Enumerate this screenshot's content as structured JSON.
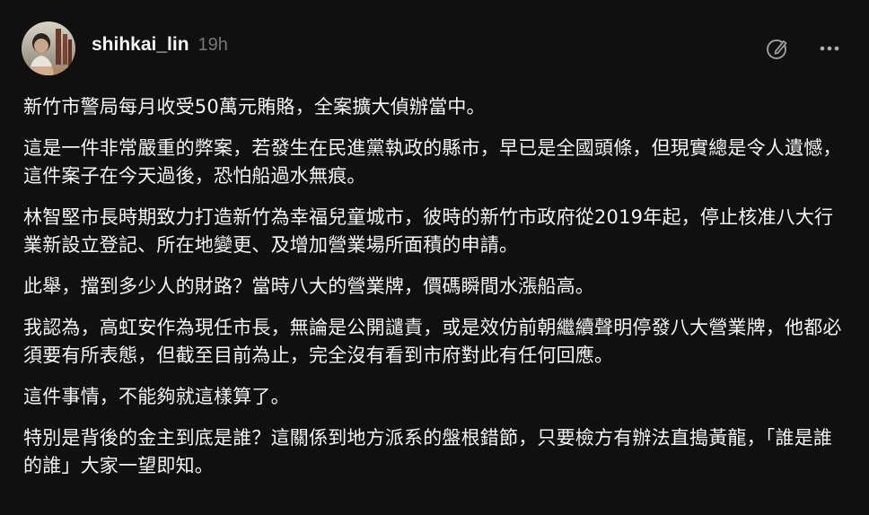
{
  "post": {
    "author": "shihkai_lin",
    "timestamp": "19h",
    "avatar_icon": "user-avatar-photo",
    "actions": {
      "edit_icon": "edit-pencil-circle-icon",
      "more_icon": "more-horizontal-icon"
    },
    "paragraphs": [
      "新竹市警局每月收受50萬元賄賂，全案擴大偵辦當中。",
      "這是一件非常嚴重的弊案，若發生在民進黨執政的縣市，早已是全國頭條，但現實總是令人遺憾，這件案子在今天過後，恐怕船過水無痕。",
      "林智堅市長時期致力打造新竹為幸福兒童城市，彼時的新竹市政府從2019年起，停止核准八大行業新設立登記、所在地變更、及增加營業場所面積的申請。",
      "此舉，擋到多少人的財路？當時八大的營業牌，價碼瞬間水漲船高。",
      "我認為，高虹安作為現任市長，無論是公開譴責，或是效仿前朝繼續聲明停發八大營業牌，他都必須要有所表態，但截至目前為止，完全沒有看到市府對此有任何回應。",
      "這件事情，不能夠就這樣算了。",
      "特別是背後的金主到底是誰？這關係到地方派系的盤根錯節，只要檢方有辦法直搗黃龍，「誰是誰的誰」大家一望即知。"
    ]
  },
  "colors": {
    "background": "#101010",
    "text_primary": "#f3f5f7",
    "text_secondary": "#777777",
    "icon": "#999999"
  }
}
